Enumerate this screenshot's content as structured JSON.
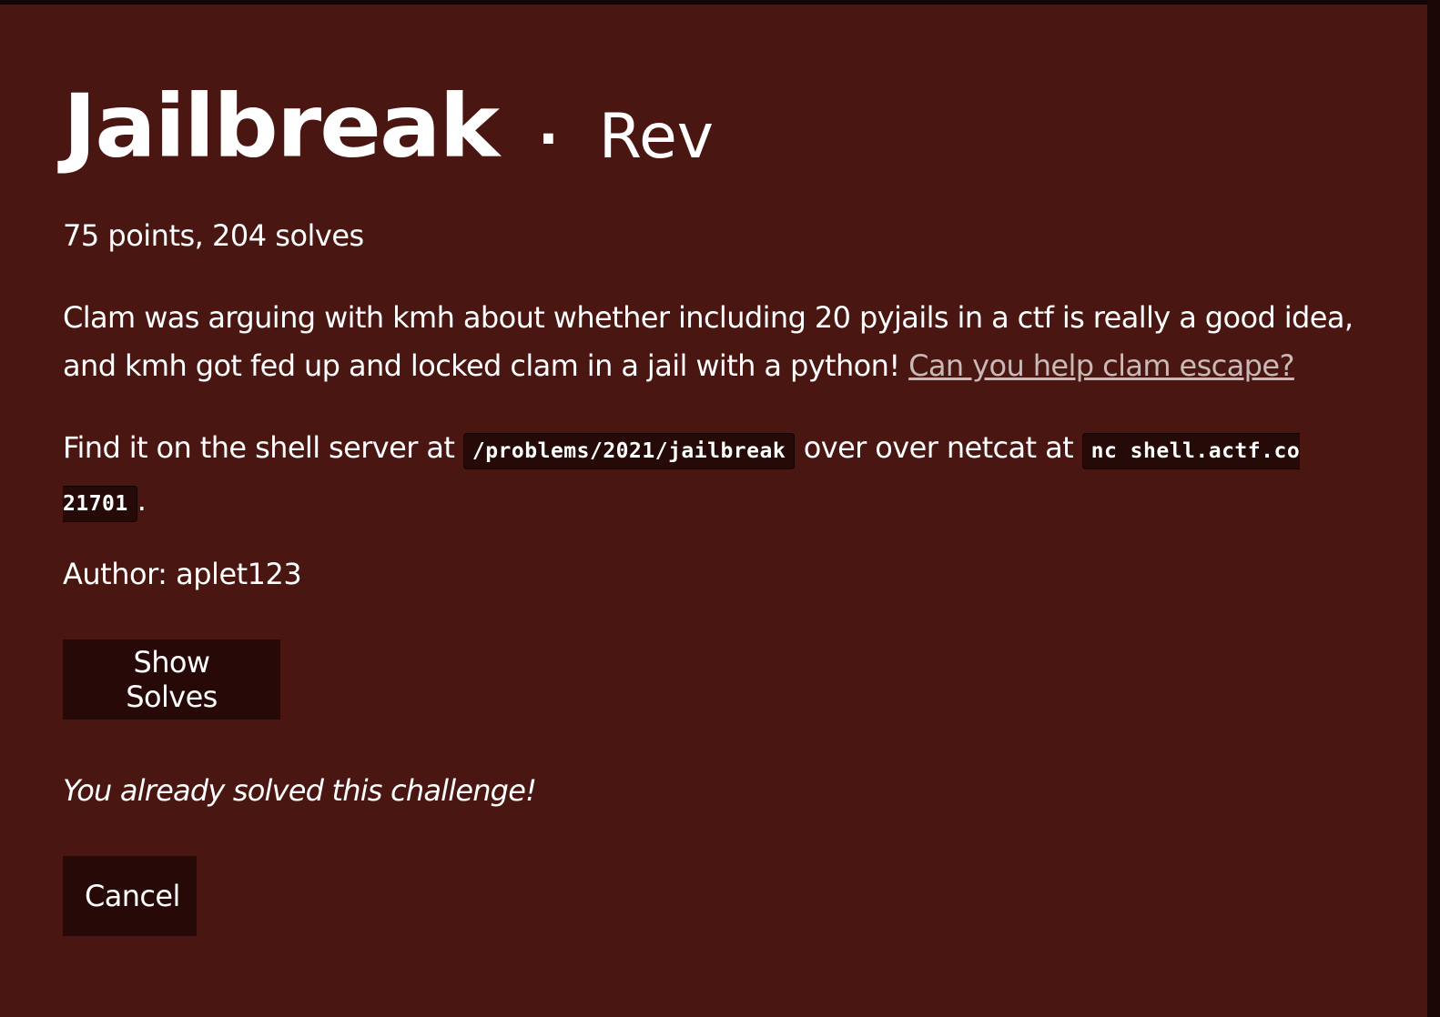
{
  "challenge": {
    "title": "Jailbreak",
    "separator": "·",
    "category": "Rev",
    "stats": "75 points, 204 solves",
    "description_text": "Clam was arguing with kmh about whether including 20 pyjails in a ctf is really a good idea, and kmh got fed up and locked clam in a jail with a python! ",
    "description_link": "Can you help clam escape?",
    "shell_prefix": "Find it on the shell server at ",
    "shell_path": "/problems/2021/jailbreak",
    "shell_middle": " over over netcat at ",
    "netcat_command": "nc shell.actf.co 21701",
    "shell_suffix": ".",
    "author": "Author: aplet123"
  },
  "buttons": {
    "show_solves": "Show Solves",
    "cancel": "Cancel"
  },
  "status": {
    "solved_message": "You already solved this challenge!"
  },
  "colors": {
    "modal_background": "#4a1612",
    "button_background": "#270907",
    "code_background": "#260a08",
    "link": "#c9b9b7"
  }
}
